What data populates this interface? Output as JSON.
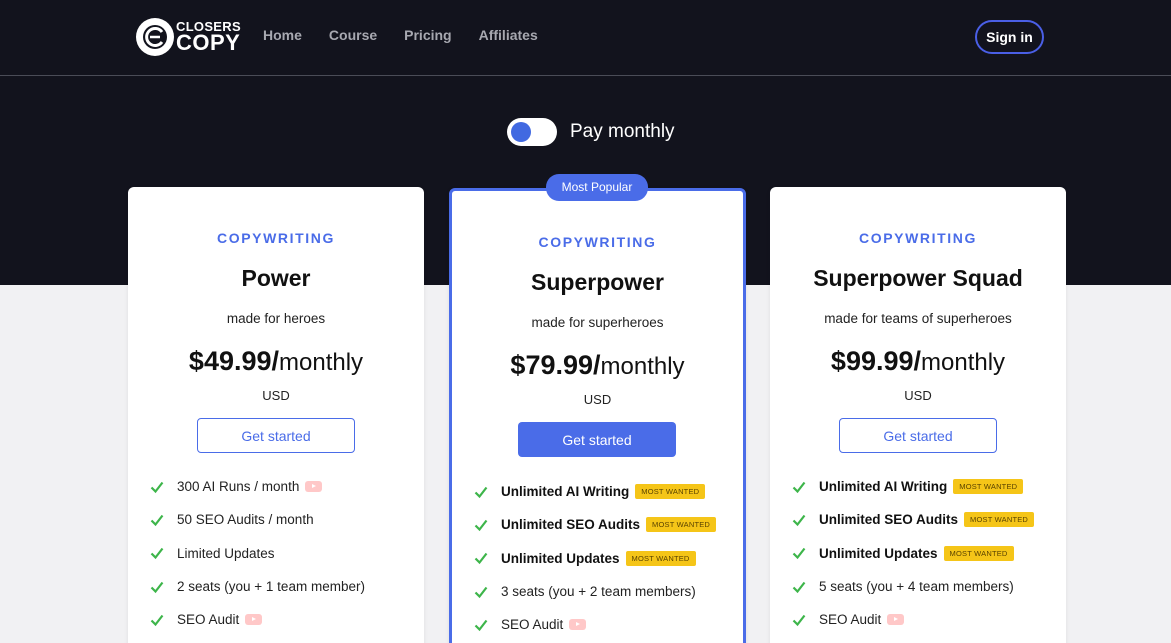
{
  "brand": {
    "line1": "CLOSERS",
    "line2": "COPY"
  },
  "nav": {
    "links": [
      "Home",
      "Course",
      "Pricing",
      "Affiliates"
    ],
    "signin": "Sign in"
  },
  "billing": {
    "label": "Pay monthly"
  },
  "colors": {
    "accent": "#4a6ce8",
    "dark_bg": "#12131d",
    "tag_yellow": "#f5c518",
    "check_green": "#3db54a"
  },
  "plans": [
    {
      "eyebrow": "COPYWRITING",
      "name": "Power",
      "tagline": "made for heroes",
      "amount": "$49.99/",
      "period": "monthly",
      "currency": "USD",
      "cta": "Get started",
      "features": [
        {
          "text": "300 AI Runs / month",
          "bold": false,
          "tag": "",
          "video": true
        },
        {
          "text": "50 SEO Audits / month",
          "bold": false,
          "tag": "",
          "video": false
        },
        {
          "text": "Limited Updates",
          "bold": false,
          "tag": "",
          "video": false
        },
        {
          "text": "2 seats (you + 1 team member)",
          "bold": false,
          "tag": "",
          "video": false
        },
        {
          "text": "SEO Audit",
          "bold": false,
          "tag": "",
          "video": true
        }
      ]
    },
    {
      "badge": "Most Popular",
      "eyebrow": "COPYWRITING",
      "name": "Superpower",
      "tagline": "made for superheroes",
      "amount": "$79.99/",
      "period": "monthly",
      "currency": "USD",
      "cta": "Get started",
      "features": [
        {
          "text": "Unlimited AI Writing",
          "bold": true,
          "tag": "MOST WANTED",
          "video": false
        },
        {
          "text": "Unlimited SEO Audits",
          "bold": true,
          "tag": "MOST WANTED",
          "video": false
        },
        {
          "text": "Unlimited Updates",
          "bold": true,
          "tag": "MOST WANTED",
          "video": false
        },
        {
          "text": "3 seats (you + 2 team members)",
          "bold": false,
          "tag": "",
          "video": false
        },
        {
          "text": "SEO Audit",
          "bold": false,
          "tag": "",
          "video": true
        }
      ]
    },
    {
      "eyebrow": "COPYWRITING",
      "name": "Superpower Squad",
      "tagline": "made for teams of superheroes",
      "amount": "$99.99/",
      "period": "monthly",
      "currency": "USD",
      "cta": "Get started",
      "features": [
        {
          "text": "Unlimited AI Writing",
          "bold": true,
          "tag": "MOST WANTED",
          "video": false
        },
        {
          "text": "Unlimited SEO Audits",
          "bold": true,
          "tag": "MOST WANTED",
          "video": false
        },
        {
          "text": "Unlimited Updates",
          "bold": true,
          "tag": "MOST WANTED",
          "video": false
        },
        {
          "text": "5 seats (you + 4 team members)",
          "bold": false,
          "tag": "",
          "video": false
        },
        {
          "text": "SEO Audit",
          "bold": false,
          "tag": "",
          "video": true
        }
      ]
    }
  ]
}
